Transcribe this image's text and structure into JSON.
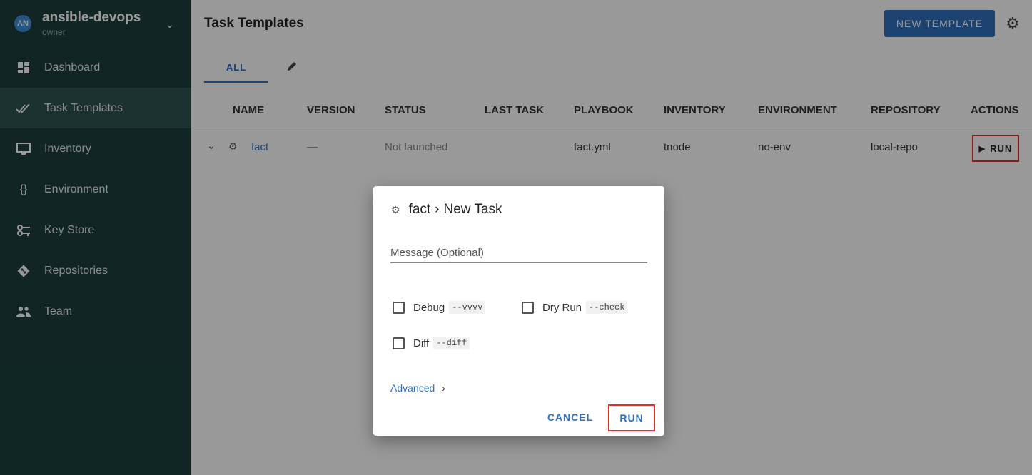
{
  "sidebar": {
    "avatar_initials": "AN",
    "project_name": "ansible-devops",
    "project_role": "owner",
    "items": [
      {
        "label": "Dashboard",
        "icon": "dashboard-icon"
      },
      {
        "label": "Task Templates",
        "icon": "double-check-icon",
        "active": true
      },
      {
        "label": "Inventory",
        "icon": "monitor-icon"
      },
      {
        "label": "Environment",
        "icon": "braces-icon"
      },
      {
        "label": "Key Store",
        "icon": "key-icon"
      },
      {
        "label": "Repositories",
        "icon": "git-icon"
      },
      {
        "label": "Team",
        "icon": "people-icon"
      }
    ]
  },
  "header": {
    "title": "Task Templates",
    "new_template_label": "NEW TEMPLATE"
  },
  "tabs": {
    "all_label": "ALL"
  },
  "table": {
    "columns": [
      "NAME",
      "VERSION",
      "STATUS",
      "LAST TASK",
      "PLAYBOOK",
      "INVENTORY",
      "ENVIRONMENT",
      "REPOSITORY",
      "ACTIONS"
    ],
    "rows": [
      {
        "name": "fact",
        "version": "—",
        "status": "Not launched",
        "last_task": "",
        "playbook": "fact.yml",
        "inventory": "tnode",
        "environment": "no-env",
        "repository": "local-repo",
        "action_label": "RUN"
      }
    ]
  },
  "dialog": {
    "template_name": "fact",
    "title": "New Task",
    "message_placeholder": "Message (Optional)",
    "options": [
      {
        "label": "Debug",
        "flag": "--vvvv",
        "checked": false
      },
      {
        "label": "Dry Run",
        "flag": "--check",
        "checked": false
      },
      {
        "label": "Diff",
        "flag": "--diff",
        "checked": false
      }
    ],
    "advanced_label": "Advanced",
    "cancel_label": "CANCEL",
    "run_label": "RUN"
  },
  "colors": {
    "sidebar_bg": "#1b3f3d",
    "accent_blue": "#2f6fbd",
    "highlight_red": "#e0302a"
  }
}
